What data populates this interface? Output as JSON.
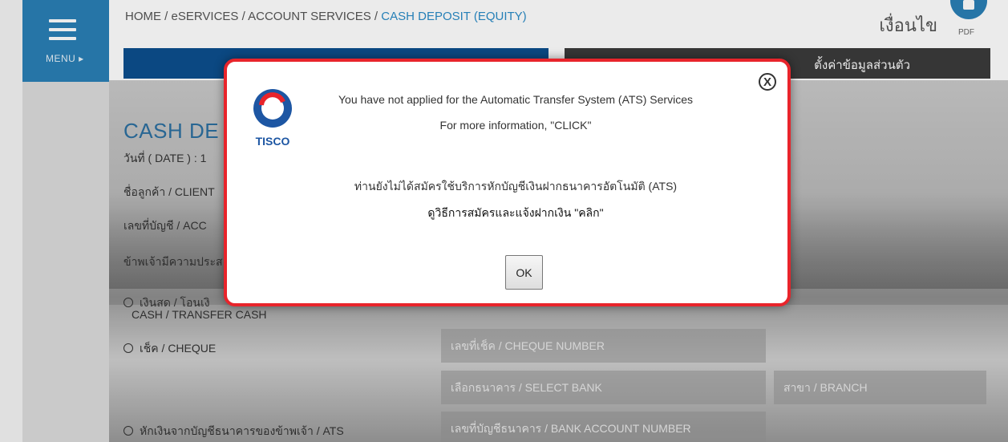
{
  "menu": {
    "label": "MENU ▸"
  },
  "breadcrumb": {
    "path": "HOME / eSERVICES / ACCOUNT SERVICES / ",
    "current": "CASH DEPOSIT (EQUITY)"
  },
  "header": {
    "conditions": "เงื่อนไข",
    "pdf_label": "PDF",
    "tab_right": "ตั้งค่าข้อมูลส่วนตัว"
  },
  "background": {
    "title": "CASH DE",
    "date": "วันที่ ( DATE ) : 1",
    "client": "ชื่อลูกค้า / CLIENT",
    "account": "เลขที่บัญชี / ACC",
    "intent": "ข้าพเจ้ามีความประส",
    "radio_cash_line1": "เงินสด / โอนเงิ",
    "radio_cash_line2": "CASH / TRANSFER CASH",
    "radio_cheque": "เช็ค / CHEQUE",
    "radio_ats": "หักเงินจากบัญชีธนาคารของข้าพเจ้า / ATS",
    "field_cheque": "เลขที่เช็ค / CHEQUE NUMBER",
    "field_bank": "เลือกธนาคาร / SELECT BANK",
    "field_branch": "สาขา / BRANCH",
    "field_bank_account": "เลขที่บัญชีธนาคาร / BANK ACCOUNT NUMBER"
  },
  "modal": {
    "logo_text": "TISCO",
    "close": "X",
    "message_en_1": "You have not applied for the Automatic Transfer System (ATS) Services",
    "message_en_2": "For more information, \"CLICK\"",
    "message_th_1": "ท่านยังไม่ได้สมัครใช้บริการหักบัญชีเงินฝากธนาคารอัตโนมัติ (ATS)",
    "message_th_2": "ดูวิธีการสมัครและแจ้งฝากเงิน \"คลิก\"",
    "ok_label": "OK"
  },
  "colors": {
    "accent": "#2a7fb6",
    "modal_border": "#e8242b",
    "tab_left": "#0d4f8e",
    "tab_right": "#3b3b3b"
  }
}
